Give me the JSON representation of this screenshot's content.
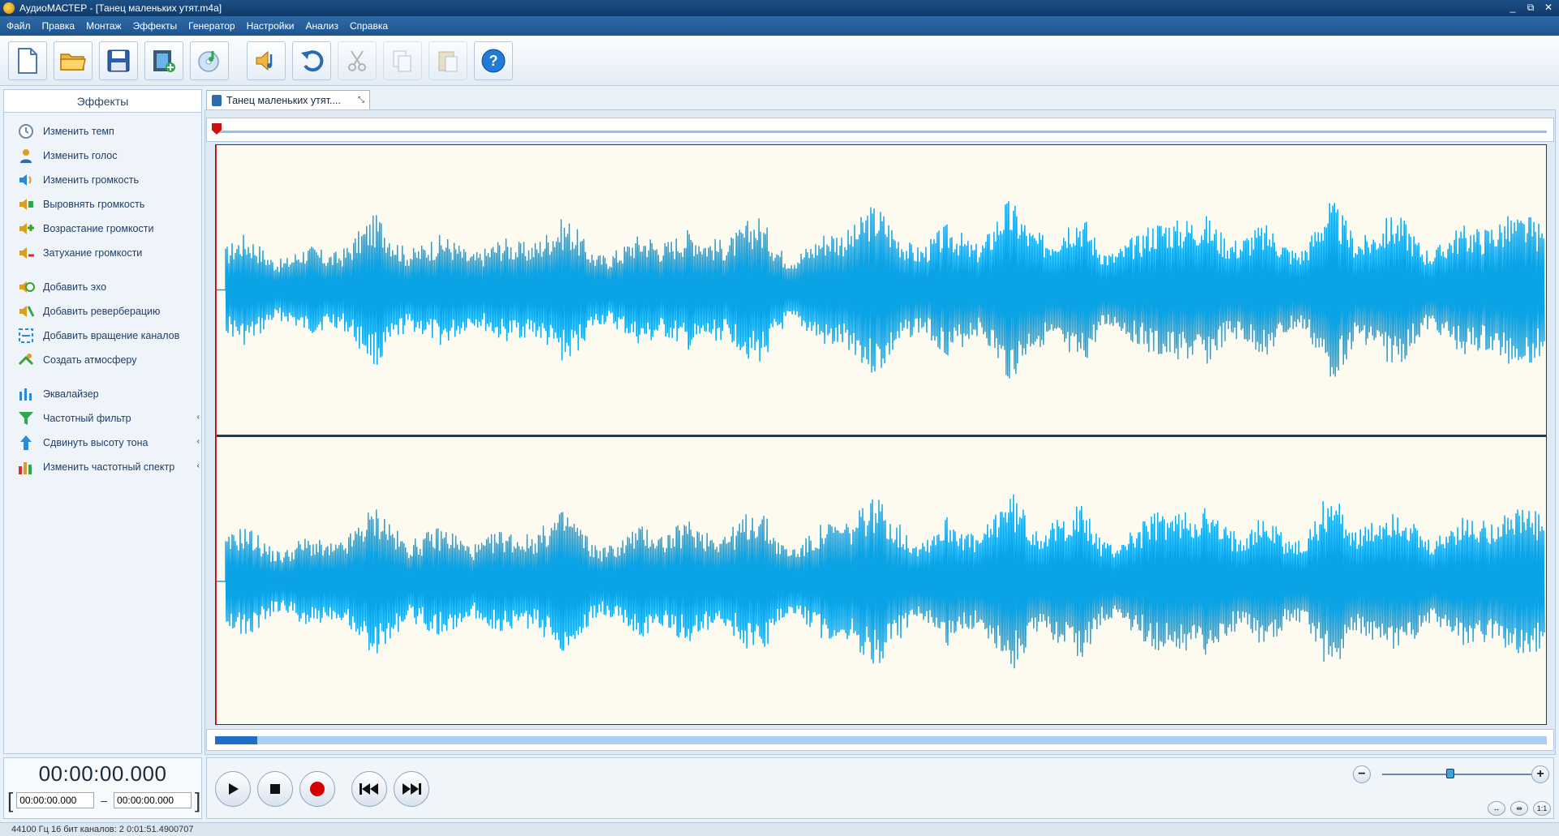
{
  "window": {
    "title": "АудиоМАСТЕР - [Танец маленьких утят.m4a]",
    "controls": [
      "_",
      "⧉",
      "✕"
    ]
  },
  "menu": {
    "items": [
      "Файл",
      "Правка",
      "Монтаж",
      "Эффекты",
      "Генератор",
      "Настройки",
      "Анализ",
      "Справка"
    ]
  },
  "toolbar": {
    "buttons": [
      {
        "icon": "new-file-icon",
        "enabled": true
      },
      {
        "icon": "open-folder-icon",
        "enabled": true
      },
      {
        "icon": "save-icon",
        "enabled": true
      },
      {
        "icon": "add-video-icon",
        "enabled": true
      },
      {
        "icon": "cd-music-icon",
        "enabled": true
      },
      {
        "icon": "speaker-note-icon",
        "enabled": true
      },
      {
        "icon": "undo-icon",
        "enabled": true
      },
      {
        "icon": "cut-icon",
        "enabled": false
      },
      {
        "icon": "copy-icon",
        "enabled": false
      },
      {
        "icon": "paste-icon",
        "enabled": false
      },
      {
        "icon": "help-icon",
        "enabled": true
      }
    ]
  },
  "effects": {
    "header": "Эффекты",
    "groups": [
      [
        {
          "label": "Изменить темп",
          "icon": "clock-icon",
          "color": "#6a8aa8"
        },
        {
          "label": "Изменить голос",
          "icon": "person-icon",
          "color": "#d9a020"
        },
        {
          "label": "Изменить громкость",
          "icon": "volume-icon",
          "color": "#2a8ad8"
        },
        {
          "label": "Выровнять громкость",
          "icon": "volume-level-icon",
          "color": "#d9a020"
        },
        {
          "label": "Возрастание громкости",
          "icon": "volume-up-icon",
          "color": "#3aa030"
        },
        {
          "label": "Затухание громкости",
          "icon": "volume-down-icon",
          "color": "#d9a020"
        }
      ],
      [
        {
          "label": "Добавить эхо",
          "icon": "echo-icon",
          "color": "#3aa030"
        },
        {
          "label": "Добавить реверберацию",
          "icon": "reverb-icon",
          "color": "#d9a020"
        },
        {
          "label": "Добавить вращение каналов",
          "icon": "rotate-channels-icon",
          "color": "#2a8ad8"
        },
        {
          "label": "Создать атмосферу",
          "icon": "atmosphere-icon",
          "color": "#3aa030"
        }
      ],
      [
        {
          "label": "Эквалайзер",
          "icon": "equalizer-icon",
          "color": "#2a8ad8",
          "chevron": false
        },
        {
          "label": "Частотный фильтр",
          "icon": "filter-icon",
          "color": "#2ea84a",
          "chevron": true
        },
        {
          "label": "Сдвинуть высоту тона",
          "icon": "pitch-icon",
          "color": "#2a8ad8",
          "chevron": true
        },
        {
          "label": "Изменить частотный спектр",
          "icon": "spectrum-icon",
          "color": "#d83030",
          "chevron": true
        }
      ]
    ]
  },
  "document_tab": {
    "label": "Танец маленьких утят...."
  },
  "time": {
    "current": "00:00:00.000",
    "range_start": "00:00:00.000",
    "range_end": "00:00:00.000"
  },
  "status": {
    "text": "44100 Гц  16 бит  каналов: 2   0:01:51.4900707"
  },
  "waveform": {
    "color": "#0aa3e6",
    "background": "#fdfaf0",
    "channels": 2,
    "envelope": [
      0.4,
      0.48,
      0.45,
      0.5,
      0.42,
      0.55,
      0.6,
      0.48,
      0.52,
      0.65,
      0.5,
      0.45,
      0.55,
      0.6,
      0.52,
      0.48,
      0.7,
      0.55,
      0.45,
      0.6,
      0.72,
      0.58,
      0.5,
      0.62,
      0.78,
      0.55,
      0.6,
      0.7,
      0.65,
      0.8,
      0.58,
      0.62,
      0.75,
      0.6,
      0.55,
      0.85,
      0.62,
      0.58,
      0.7,
      0.66,
      0.6,
      0.78,
      0.55,
      0.62,
      0.72,
      0.6,
      0.66,
      0.8,
      0.58,
      0.65
    ]
  },
  "transport": {
    "buttons": [
      "play-icon",
      "stop-icon",
      "record-icon",
      "rewind-icon",
      "fast-forward-icon"
    ]
  },
  "zoom": {
    "level": 0.45,
    "buttons": [
      "zoom-out-icon",
      "zoom-in-icon",
      "fit-width-icon",
      "fit-selection-icon",
      "zoom-1to1-icon"
    ],
    "one_to_one_label": "1:1"
  }
}
